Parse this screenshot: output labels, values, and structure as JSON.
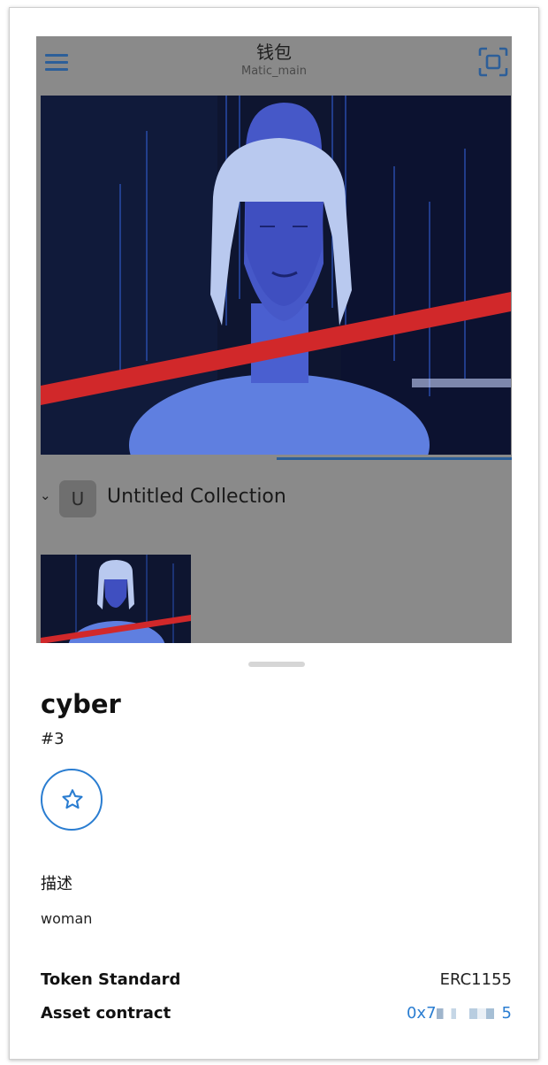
{
  "header": {
    "title": "钱包",
    "network": "Matic_main"
  },
  "collection": {
    "avatar_letter": "U",
    "name": "Untitled Collection"
  },
  "nft": {
    "name": "cyber",
    "token_id": "#3",
    "description_heading": "描述",
    "description": "woman"
  },
  "details": {
    "token_standard_label": "Token Standard",
    "token_standard_value": "ERC1155",
    "asset_contract_label": "Asset contract",
    "asset_contract_prefix": "0x7",
    "asset_contract_suffix": "5"
  },
  "colors": {
    "accent": "#2a7dd1",
    "dim_overlay": "#8a8a8a"
  },
  "icons": [
    "hamburger-icon",
    "scan-icon",
    "chevron-down-icon",
    "star-icon"
  ]
}
